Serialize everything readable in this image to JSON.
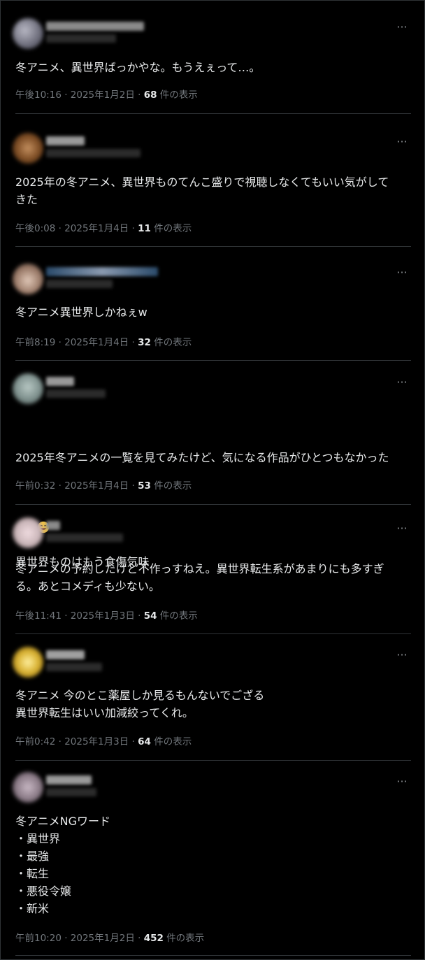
{
  "ui": {
    "more_label": "···"
  },
  "posts": [
    {
      "text": "冬アニメ、異世界ばっかやな。もうえぇって…。",
      "time": "午後10:16",
      "date": "2025年1月2日",
      "views": "68",
      "views_suffix": "件の表示"
    },
    {
      "text": "2025年の冬アニメ、異世界ものてんこ盛りで視聴しなくてもいい気がして\nきた",
      "time": "午後0:08",
      "date": "2025年1月4日",
      "views": "11",
      "views_suffix": "件の表示"
    },
    {
      "text": "冬アニメ異世界しかねぇw",
      "time": "午前8:19",
      "date": "2025年1月4日",
      "views": "32",
      "views_suffix": "件の表示"
    },
    {
      "text": "2025年冬アニメの一覧を見てみたけど、気になる作品がひとつもなかった",
      "text_line2": "異世界ものはもう食傷気味",
      "emoji": "sweat-smile-emoji",
      "time": "午前0:32",
      "date": "2025年1月4日",
      "views": "53",
      "views_suffix": "件の表示"
    },
    {
      "text": "冬アニメの予約したけど不作っすねえ。異世界転生系があまりにも多すぎ\nる。あとコメディも少ない。",
      "time": "午後11:41",
      "date": "2025年1月3日",
      "views": "54",
      "views_suffix": "件の表示"
    },
    {
      "text": "冬アニメ 今のとこ薬屋しか見るもんないでござる\n異世界転生はいい加減絞ってくれ。",
      "time": "午前0:42",
      "date": "2025年1月3日",
      "views": "64",
      "views_suffix": "件の表示"
    },
    {
      "text": "冬アニメNGワード\n・異世界\n・最強\n・転生\n・悪役令嬢\n・新米",
      "time": "午前10:20",
      "date": "2025年1月2日",
      "views": "452",
      "views_suffix": "件の表示"
    }
  ],
  "separator": " · ",
  "colors": {
    "background": "#000000",
    "text": "#e7e9ea",
    "muted": "#71767b",
    "divider": "#2f3336",
    "avatars": [
      "#8a8a96",
      "#8a5a2e",
      "#9a7a68",
      "#7d8f8c",
      "#c9b5b8",
      "#d8b030",
      "#8a7a86"
    ]
  }
}
